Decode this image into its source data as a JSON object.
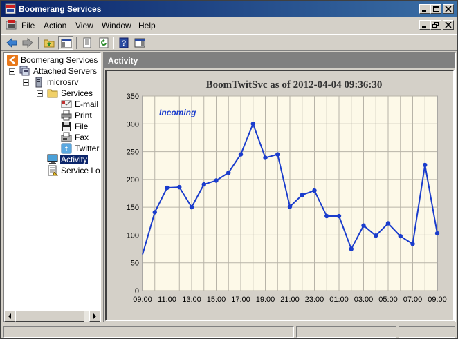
{
  "window": {
    "title": "Boomerang Services"
  },
  "menu": {
    "file": "File",
    "action": "Action",
    "view": "View",
    "window": "Window",
    "help": "Help"
  },
  "tree": {
    "root": "Boomerang Services",
    "attached_servers": "Attached Servers",
    "server": "microsrv",
    "services": "Services",
    "items": [
      "E-mail",
      "Print",
      "File",
      "Fax",
      "Twitter"
    ],
    "activity": "Activity",
    "service_log": "Service Log"
  },
  "content": {
    "header": "Activity"
  },
  "chart_data": {
    "type": "line",
    "title": "BoomTwitSvc as of 2012-04-04 09:36:30",
    "annotation": "Incoming",
    "x_tick_labels": [
      "09:00",
      "11:00",
      "13:00",
      "15:00",
      "17:00",
      "19:00",
      "21:00",
      "23:00",
      "01:00",
      "03:00",
      "05:00",
      "07:00",
      "09:00"
    ],
    "y_ticks": [
      0,
      50,
      100,
      150,
      200,
      250,
      300,
      350
    ],
    "ylim": [
      0,
      350
    ],
    "xlim": [
      0,
      24
    ],
    "grid": true,
    "series": [
      {
        "color": "#1a3ccc",
        "x": [
          0,
          1,
          2,
          3,
          4,
          5,
          6,
          7,
          8,
          9,
          10,
          11,
          12,
          13,
          14,
          15,
          16,
          17,
          18,
          19,
          20,
          21,
          22,
          23,
          24
        ],
        "values": [
          65,
          141,
          185,
          186,
          150,
          191,
          198,
          212,
          245,
          300,
          239,
          245,
          151,
          172,
          180,
          134,
          134,
          75,
          117,
          99,
          121,
          98,
          84,
          226,
          103
        ]
      }
    ],
    "colors": {
      "background": "#fdf9e8",
      "grid": "#b8b4a8",
      "line": "#1a3ccc",
      "title": "#333333"
    }
  }
}
